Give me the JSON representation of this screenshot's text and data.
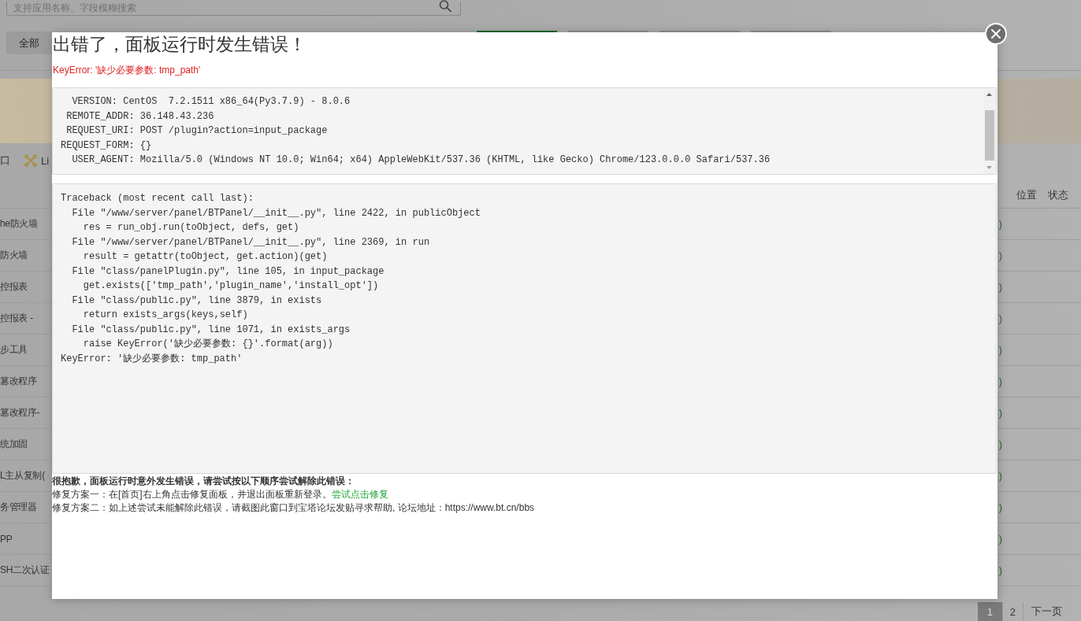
{
  "search": {
    "placeholder": "支持应用名称、字段模糊搜索"
  },
  "category_tabs": [
    {
      "label": "全部",
      "selected": false
    },
    {
      "selected": true
    },
    {
      "selected": false
    },
    {
      "selected": false
    },
    {
      "selected": false
    }
  ],
  "toolbar_items": [
    {
      "kind": "plain",
      "label": "口"
    },
    {
      "kind": "tools",
      "label": "Li"
    }
  ],
  "table": {
    "columns": [
      "位置",
      "状态"
    ],
    "rows": [
      {
        "name": "he防火墙",
        "status": ")"
      },
      {
        "name": "防火墙",
        "status": ")"
      },
      {
        "name": "控报表",
        "status": ")"
      },
      {
        "name": "控报表 -",
        "status": ")"
      },
      {
        "name": "步工具",
        "status": ")"
      },
      {
        "name": "篡改程序",
        "status": ")"
      },
      {
        "name": "篡改程序-",
        "status": ")"
      },
      {
        "name": "统加固",
        "status": ")"
      },
      {
        "name": "L主从复制(",
        "status": ")"
      },
      {
        "name": "务管理器",
        "status": ")"
      },
      {
        "name": "PP",
        "status": ")"
      },
      {
        "name": "SH二次认证",
        "status": ")"
      }
    ]
  },
  "pagination": {
    "pages": [
      {
        "label": "1",
        "selected": true
      },
      {
        "label": "2",
        "selected": false
      }
    ],
    "next": "下一页"
  },
  "dialog": {
    "title": "出错了，面板运行时发生错误！",
    "error": "KeyError: '缺少必要参数: tmp_path'",
    "request_info": [
      "  VERSION: CentOS  7.2.1511 x86_64(Py3.7.9) - 8.0.6",
      " REMOTE_ADDR: 36.148.43.236",
      " REQUEST_URI: POST /plugin?action=input_package",
      "REQUEST_FORM: {}",
      "  USER_AGENT: Mozilla/5.0 (Windows NT 10.0; Win64; x64) AppleWebKit/537.36 (KHTML, like Gecko) Chrome/123.0.0.0 Safari/537.36"
    ],
    "traceback": [
      "Traceback (most recent call last):",
      "  File \"/www/server/panel/BTPanel/__init__.py\", line 2422, in publicObject",
      "    res = run_obj.run(toObject, defs, get)",
      "  File \"/www/server/panel/BTPanel/__init__.py\", line 2369, in run",
      "    result = getattr(toObject, get.action)(get)",
      "  File \"class/panelPlugin.py\", line 105, in input_package",
      "    get.exists(['tmp_path','plugin_name','install_opt'])",
      "  File \"class/public.py\", line 3879, in exists",
      "    return exists_args(keys,self)",
      "  File \"class/public.py\", line 1071, in exists_args",
      "    raise KeyError('缺少必要参数: {}'.format(arg))",
      "KeyError: '缺少必要参数: tmp_path'"
    ],
    "help": {
      "heading": "很抱歉，面板运行时意外发生错误，请尝试按以下顺序尝试解除此错误：",
      "fixes": [
        {
          "text": "修复方案一：在[首页]右上角点击修复面板，并退出面板重新登录。",
          "link": "尝试点击修复"
        },
        {
          "text": "修复方案二：如上述尝试未能解除此错误，请截图此窗口到宝塔论坛发贴寻求帮助, 论坛地址：https://www.bt.cn/bbs"
        }
      ]
    }
  }
}
